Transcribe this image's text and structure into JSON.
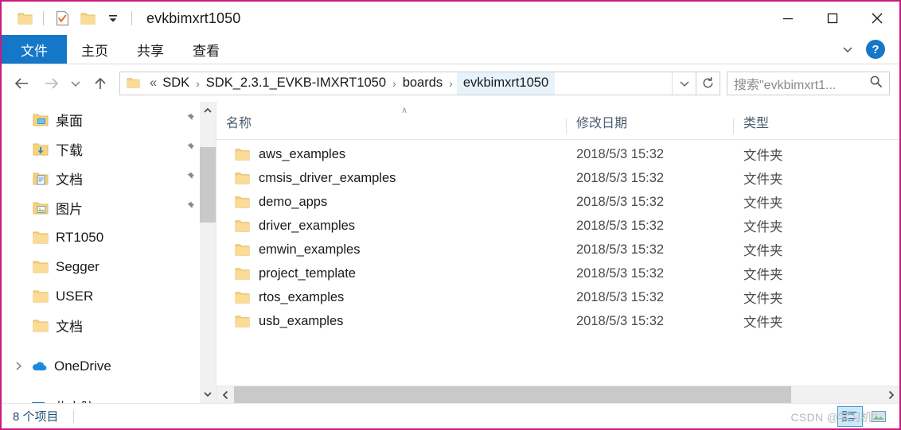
{
  "window": {
    "title": "evkbimxrt1050",
    "border_color": "#CB1A80",
    "minimize_label": "—",
    "maximize_label": "□",
    "close_label": "✕"
  },
  "quick_access": {
    "folder_icon": "folder-icon",
    "properties_icon": "properties-checkmark-icon",
    "new_folder_icon": "new-folder-icon",
    "customize_icon": "customize-dropdown-icon"
  },
  "ribbon": {
    "tabs": [
      {
        "label": "文件",
        "active": true
      },
      {
        "label": "主页",
        "active": false
      },
      {
        "label": "共享",
        "active": false
      },
      {
        "label": "查看",
        "active": false
      }
    ],
    "expand_icon": "chevron-down-icon",
    "help_label": "?",
    "accent_color": "#1577C7"
  },
  "address_bar": {
    "back_icon": "arrow-left-icon",
    "forward_icon": "arrow-right-icon",
    "recent_icon": "chevron-down-icon",
    "up_icon": "arrow-up-icon",
    "folder_icon": "folder-icon",
    "overflow": "«",
    "crumbs": [
      {
        "label": "SDK",
        "current": false
      },
      {
        "label": "SDK_2.3.1_EVKB-IMXRT1050",
        "current": false
      },
      {
        "label": "boards",
        "current": false
      },
      {
        "label": "evkbimxrt1050",
        "current": true
      }
    ],
    "separator": "›",
    "dropdown_icon": "chevron-down-icon",
    "refresh_icon": "refresh-icon"
  },
  "search": {
    "placeholder": "搜索\"evkbimxrt1...",
    "icon": "search-icon"
  },
  "sidebar": {
    "items": [
      {
        "label": "桌面",
        "icon": "desktop-folder-icon",
        "pinned": true,
        "indent": true,
        "twisty": ""
      },
      {
        "label": "下载",
        "icon": "downloads-folder-icon",
        "pinned": true,
        "indent": true,
        "twisty": ""
      },
      {
        "label": "文档",
        "icon": "documents-folder-icon",
        "pinned": true,
        "indent": true,
        "twisty": ""
      },
      {
        "label": "图片",
        "icon": "pictures-folder-icon",
        "pinned": true,
        "indent": true,
        "twisty": ""
      },
      {
        "label": "RT1050",
        "icon": "folder-icon",
        "pinned": false,
        "indent": true,
        "twisty": ""
      },
      {
        "label": "Segger",
        "icon": "folder-icon",
        "pinned": false,
        "indent": true,
        "twisty": ""
      },
      {
        "label": "USER",
        "icon": "folder-icon",
        "pinned": false,
        "indent": true,
        "twisty": ""
      },
      {
        "label": "文档",
        "icon": "folder-icon",
        "pinned": false,
        "indent": true,
        "twisty": ""
      },
      {
        "label": "OneDrive",
        "icon": "onedrive-cloud-icon",
        "pinned": false,
        "indent": false,
        "twisty": "collapsed"
      },
      {
        "label": "此电脑",
        "icon": "this-pc-icon",
        "pinned": false,
        "indent": false,
        "twisty": "expanded"
      }
    ],
    "scrollbar": {
      "up_icon": "chevron-up-icon",
      "down_icon": "chevron-down-icon"
    }
  },
  "filelist": {
    "columns": [
      {
        "key": "name",
        "label": "名称"
      },
      {
        "key": "date",
        "label": "修改日期"
      },
      {
        "key": "type",
        "label": "类型"
      }
    ],
    "sort_indicator": "∧",
    "rows": [
      {
        "name": "aws_examples",
        "date": "2018/5/3 15:32",
        "type": "文件夹",
        "icon": "folder-icon"
      },
      {
        "name": "cmsis_driver_examples",
        "date": "2018/5/3 15:32",
        "type": "文件夹",
        "icon": "folder-icon"
      },
      {
        "name": "demo_apps",
        "date": "2018/5/3 15:32",
        "type": "文件夹",
        "icon": "folder-icon"
      },
      {
        "name": "driver_examples",
        "date": "2018/5/3 15:32",
        "type": "文件夹",
        "icon": "folder-icon"
      },
      {
        "name": "emwin_examples",
        "date": "2018/5/3 15:32",
        "type": "文件夹",
        "icon": "folder-icon"
      },
      {
        "name": "project_template",
        "date": "2018/5/3 15:32",
        "type": "文件夹",
        "icon": "folder-icon"
      },
      {
        "name": "rtos_examples",
        "date": "2018/5/3 15:32",
        "type": "文件夹",
        "icon": "folder-icon"
      },
      {
        "name": "usb_examples",
        "date": "2018/5/3 15:32",
        "type": "文件夹",
        "icon": "folder-icon"
      }
    ],
    "hscroll": {
      "left_icon": "chevron-left-icon",
      "right_icon": "chevron-right-icon"
    }
  },
  "statusbar": {
    "item_count": "8 个项目",
    "details_view_icon": "details-view-icon",
    "large_icons_view_icon": "large-icons-view-icon",
    "watermark": "CSDN @学习机"
  }
}
